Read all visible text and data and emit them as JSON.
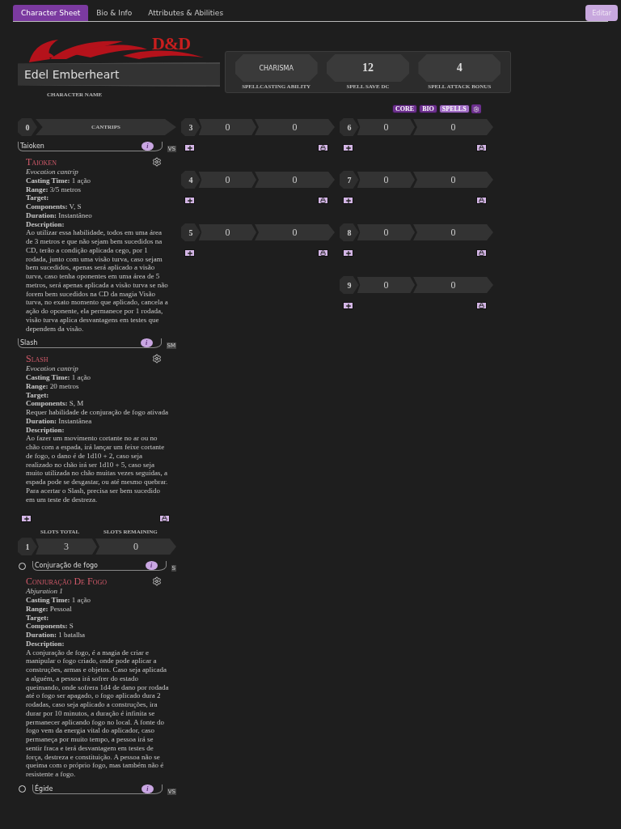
{
  "tabs": [
    {
      "label": "Character Sheet",
      "selected": true
    },
    {
      "label": "Bio & Info",
      "selected": false
    },
    {
      "label": "Attributes & Abilities",
      "selected": false
    }
  ],
  "edit_button": "Editar",
  "logo": "D&D",
  "character_name": "Edel Emberheart",
  "character_name_label": "CHARACTER NAME",
  "spellcasting": [
    {
      "label": "SPELLCASTING ABILITY",
      "value": "CHARISMA",
      "kind": "text"
    },
    {
      "label": "SPELL SAVE DC",
      "value": "12",
      "kind": "number"
    },
    {
      "label": "SPELL ATTACK BONUS",
      "value": "4",
      "kind": "number"
    }
  ],
  "section_tags": [
    {
      "label": "CORE",
      "selected": false
    },
    {
      "label": "BIO",
      "selected": false
    },
    {
      "label": "SPELLS",
      "selected": true
    }
  ],
  "cantrips": {
    "level": "0",
    "label": "CANTRIPS",
    "spells": [
      {
        "field": "Taioken",
        "info": "i",
        "components_tag": "VS",
        "title": "Taioken",
        "school": "Evocation cantrip",
        "lines": [
          {
            "kind": "field",
            "label": "Casting Time:",
            "value": "1 ação"
          },
          {
            "kind": "field",
            "label": "Range:",
            "value": "3/5 metros"
          },
          {
            "kind": "field",
            "label": "Target:"
          },
          {
            "kind": "field",
            "label": "Components:",
            "value": "V, S"
          },
          {
            "kind": "field",
            "label": "Duration:",
            "value": "Instantâneo"
          },
          {
            "kind": "field",
            "label": "Description:"
          }
        ],
        "description": "Ao utilizar essa habilidade, todos em uma área de 3 metros e que não sejam bem sucedidos na CD, terão a condição aplicada cego, por 1 rodada, junto com uma visão turva, caso sejam bem sucedidos, apenas será aplicado a visão turva, caso tenha oponentes em uma área de 5 metros, será apenas aplicada a visão turva se não forem bem sucedidos na CD da magia Visão turva, no exato momento que aplicado, cancela a ação do oponente, ela permanece por 1 rodada, visão turva aplica desvantagens em testes que dependem da visão."
      },
      {
        "field": "Slash",
        "info": "i",
        "components_tag": "SM",
        "title": "Slash",
        "school": "Evocation cantrip",
        "lines": [
          {
            "kind": "field",
            "label": "Casting Time:",
            "value": "1 ação"
          },
          {
            "kind": "field",
            "label": "Range:",
            "value": "20 metros"
          },
          {
            "kind": "field",
            "label": "Target:"
          },
          {
            "kind": "field",
            "label": "Components:",
            "value": "S, M"
          },
          {
            "kind": "note",
            "value": "Requer habilidade de conjuração de fogo ativada"
          },
          {
            "kind": "field",
            "label": "Duration:",
            "value": "Instantânea"
          },
          {
            "kind": "field",
            "label": "Description:"
          }
        ],
        "description": "Ao fazer um movimento cortante no ar ou no chão com a espada, irá lançar um feixe cortante de fogo, o dano é de 1d10 + 2, caso seja realizado no chão irá ser 1d10 + 5, caso seja muito utilizada no chão muitas vezes seguidas, a espada pode se desgastar, ou até mesmo quebrar. Para acertar o Slash, precisa ser bem sucedido em um teste de destreza."
      }
    ]
  },
  "level_1": {
    "level": "1",
    "slots_total_label": "SLOTS TOTAL",
    "slots_remaining_label": "SLOTS REMAINING",
    "slots_total": "3",
    "slots_remaining": "0",
    "spells": [
      {
        "prepared": false,
        "field": "Conjuração de fogo",
        "info": "i",
        "components_tag": "S",
        "title": "Conjuração De Fogo",
        "school": "Abjuration 1",
        "lines": [
          {
            "kind": "field",
            "label": "Casting Time:",
            "value": "1 ação"
          },
          {
            "kind": "field",
            "label": "Range:",
            "value": "Pessoal"
          },
          {
            "kind": "field",
            "label": "Target:"
          },
          {
            "kind": "field",
            "label": "Components:",
            "value": "S"
          },
          {
            "kind": "field",
            "label": "Duration:",
            "value": "1 batalha"
          },
          {
            "kind": "field",
            "label": "Description:"
          }
        ],
        "description": "A conjuração de fogo, é a magia de criar e manipular o fogo criado, onde pode aplicar a construções, armas e objetos. Caso seja aplicada a alguém, a pessoa irá sofrer do estado queimando, onde sofrera 1d4 de dano por rodada até o fogo ser apagado, o fogo aplicado dura 2 rodadas, caso seja aplicado a construções, ira durar por 10 minutos, a duração é infinita se permanecer aplicando fogo no local. A fonte do fogo vem da energia vital do aplicador, caso permaneça por muito tempo, a pessoa irá se sentir fraca e terá desvantagem em testes de força, destreza e constituição. A pessoa não se queima com o próprio fogo, mas também não é resistente a fogo."
      },
      {
        "prepared": false,
        "field": "Égide",
        "info": "i",
        "components_tag": "VS"
      }
    ]
  },
  "level_columns": [
    {
      "levels": [
        {
          "level": "3",
          "slots_total": "0",
          "slots_remaining": "0"
        },
        {
          "level": "4",
          "slots_total": "0",
          "slots_remaining": "0"
        },
        {
          "level": "5",
          "slots_total": "0",
          "slots_remaining": "0"
        }
      ]
    },
    {
      "levels": [
        {
          "level": "6",
          "slots_total": "0",
          "slots_remaining": "0"
        },
        {
          "level": "7",
          "slots_total": "0",
          "slots_remaining": "0"
        },
        {
          "level": "8",
          "slots_total": "0",
          "slots_remaining": "0"
        },
        {
          "level": "9",
          "slots_total": "0",
          "slots_remaining": "0"
        }
      ]
    }
  ]
}
